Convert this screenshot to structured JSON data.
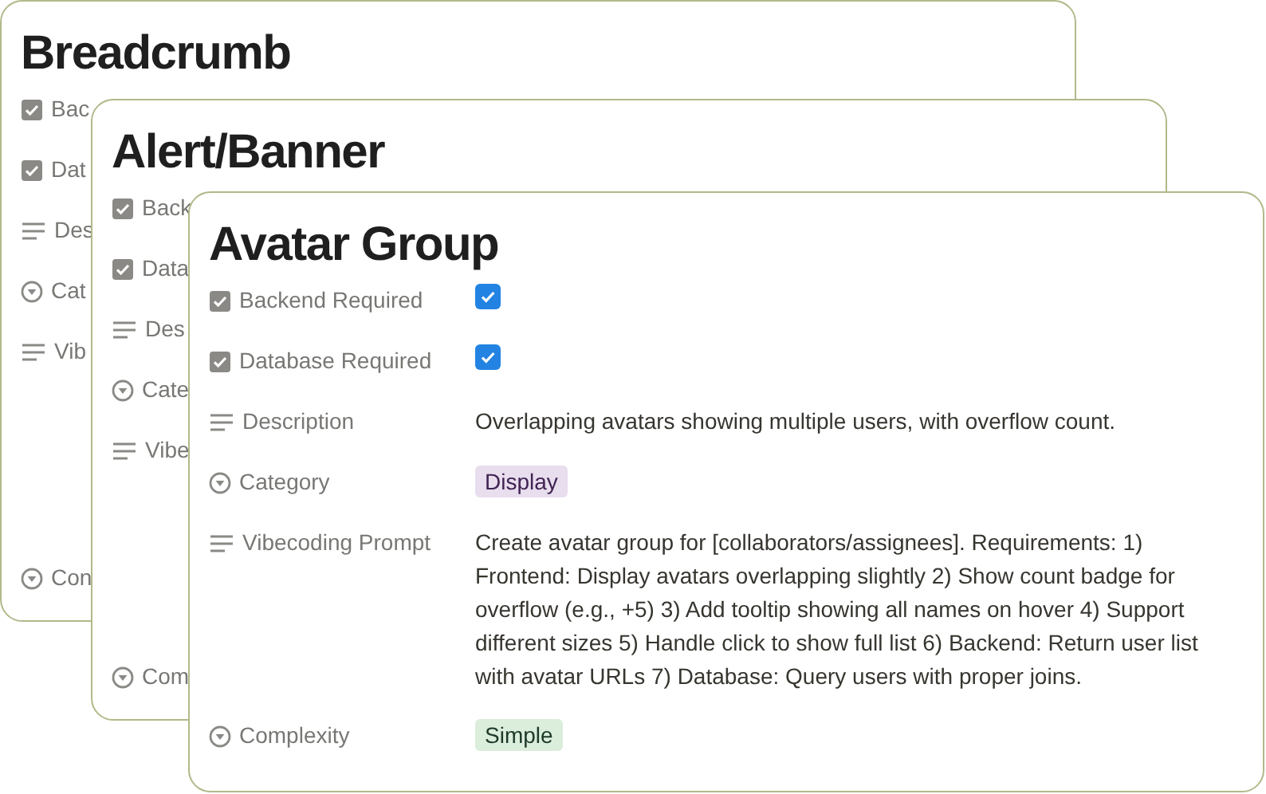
{
  "cards": [
    {
      "title": "Breadcrumb",
      "properties": [
        {
          "kind": "checkbox",
          "label": "Bac"
        },
        {
          "kind": "checkbox",
          "label": "Dat"
        },
        {
          "kind": "text",
          "label": "Des"
        },
        {
          "kind": "select",
          "label": "Cat"
        },
        {
          "kind": "text",
          "label": "Vib"
        },
        {
          "kind": "select",
          "label": "Con"
        }
      ]
    },
    {
      "title": "Alert/Banner",
      "properties": [
        {
          "kind": "checkbox",
          "label": "Back"
        },
        {
          "kind": "checkbox",
          "label": "Data"
        },
        {
          "kind": "text",
          "label": "Des"
        },
        {
          "kind": "select",
          "label": "Cate"
        },
        {
          "kind": "text",
          "label": "Vibe"
        },
        {
          "kind": "select",
          "label": "Com"
        }
      ]
    },
    {
      "title": "Avatar Group",
      "properties": [
        {
          "kind": "checkbox",
          "label": "Backend Required",
          "checked": true
        },
        {
          "kind": "checkbox",
          "label": "Database Required",
          "checked": true
        },
        {
          "kind": "text",
          "label": "Description",
          "value": "Overlapping avatars showing multiple users, with overflow count."
        },
        {
          "kind": "select",
          "label": "Category",
          "value": "Display",
          "color": "#e8deee"
        },
        {
          "kind": "text",
          "label": "Vibecoding Prompt",
          "value": "Create avatar group for [collaborators/assignees]. Requirements: 1) Frontend: Display avatars overlapping slightly 2) Show count badge for overflow (e.g., +5) 3) Add tooltip showing all names on hover 4) Support different sizes 5) Handle click to show full list 6) Backend: Return user list with avatar URLs 7) Database: Query users with proper joins."
        },
        {
          "kind": "select",
          "label": "Complexity",
          "value": "Simple",
          "color": "#dbeddb"
        }
      ]
    }
  ]
}
